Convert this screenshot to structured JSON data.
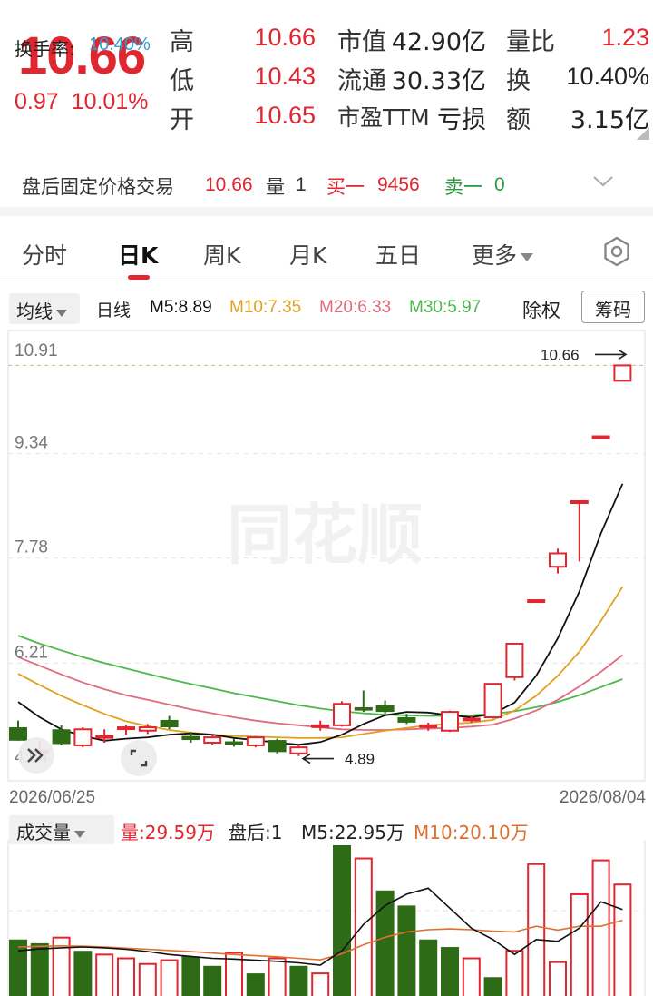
{
  "quote": {
    "price": "10.66",
    "change": "0.97",
    "change_pct": "10.01%",
    "high_label": "高",
    "high": "10.66",
    "low_label": "低",
    "low": "10.43",
    "open_label": "开",
    "open": "10.65",
    "mktcap_label": "市值",
    "mktcap": "42.90亿",
    "float_label": "流通",
    "float": "30.33亿",
    "pe_label": "市盈TTM",
    "pe": "亏损",
    "vol_ratio_label": "量比",
    "vol_ratio": "1.23",
    "turnover_label": "换",
    "turnover": "10.40%",
    "amount_label": "额",
    "amount": "3.15亿"
  },
  "after_hours": {
    "label": "盘后固定价格交易",
    "price": "10.66",
    "vol_label": "量",
    "vol": "1",
    "buy1_label": "买一",
    "buy1": "9456",
    "sell1_label": "卖一",
    "sell1": "0"
  },
  "tabs": [
    "分时",
    "日K",
    "周K",
    "月K",
    "五日",
    "更多"
  ],
  "active_tab": "日K",
  "indicators": {
    "ma_button": "均线",
    "period": "日线",
    "m5": "M5:8.89",
    "m10": "M10:7.35",
    "m20": "M20:6.33",
    "m30": "M30:5.97",
    "adjust": "除权",
    "chips": "筹码"
  },
  "colors": {
    "up": "#e0262f",
    "down": "#2e6b17",
    "m5": "#111111",
    "m10": "#e0a020",
    "m20": "#e06a80",
    "m30": "#4cb84c",
    "turnover": "#2a9fd6"
  },
  "chart_data": {
    "type": "candlestick",
    "y_ticks": [
      "10.91",
      "9.34",
      "7.78",
      "6.21",
      "4.64"
    ],
    "ylim": [
      4.64,
      10.91
    ],
    "x_start": "2026/06/25",
    "x_end": "2026/08/04",
    "max_annotation": "10.66",
    "min_annotation": "4.89",
    "watermark": "同花顺",
    "candles": [
      {
        "o": 5.25,
        "h": 5.35,
        "l": 5.05,
        "c": 5.05
      },
      {
        "o": 4.9,
        "h": 5.05,
        "l": 4.85,
        "c": 4.9
      },
      {
        "o": 5.22,
        "h": 5.28,
        "l": 4.98,
        "c": 5.0
      },
      {
        "o": 4.98,
        "h": 5.25,
        "l": 4.95,
        "c": 5.22
      },
      {
        "o": 5.12,
        "h": 5.22,
        "l": 5.02,
        "c": 5.12
      },
      {
        "o": 5.25,
        "h": 5.28,
        "l": 5.14,
        "c": 5.25
      },
      {
        "o": 5.2,
        "h": 5.3,
        "l": 5.15,
        "c": 5.25
      },
      {
        "o": 5.36,
        "h": 5.42,
        "l": 5.22,
        "c": 5.25
      },
      {
        "o": 5.12,
        "h": 5.18,
        "l": 5.02,
        "c": 5.06
      },
      {
        "o": 5.02,
        "h": 5.15,
        "l": 4.98,
        "c": 5.1
      },
      {
        "o": 5.04,
        "h": 5.08,
        "l": 4.96,
        "c": 4.99
      },
      {
        "o": 4.98,
        "h": 5.12,
        "l": 4.95,
        "c": 5.1
      },
      {
        "o": 5.06,
        "h": 5.08,
        "l": 4.86,
        "c": 4.88
      },
      {
        "o": 4.86,
        "h": 4.98,
        "l": 4.82,
        "c": 4.95
      },
      {
        "o": 5.26,
        "h": 5.35,
        "l": 5.2,
        "c": 5.28
      },
      {
        "o": 5.28,
        "h": 5.64,
        "l": 5.26,
        "c": 5.6
      },
      {
        "o": 5.55,
        "h": 5.8,
        "l": 5.48,
        "c": 5.5
      },
      {
        "o": 5.58,
        "h": 5.65,
        "l": 5.45,
        "c": 5.48
      },
      {
        "o": 5.4,
        "h": 5.45,
        "l": 5.3,
        "c": 5.32
      },
      {
        "o": 5.28,
        "h": 5.32,
        "l": 5.2,
        "c": 5.28
      },
      {
        "o": 5.2,
        "h": 5.5,
        "l": 5.18,
        "c": 5.48
      },
      {
        "o": 5.38,
        "h": 5.44,
        "l": 5.32,
        "c": 5.38
      },
      {
        "o": 5.4,
        "h": 5.9,
        "l": 5.38,
        "c": 5.9
      },
      {
        "o": 6.0,
        "h": 6.5,
        "l": 5.95,
        "c": 6.5
      },
      {
        "o": 7.15,
        "h": 7.15,
        "l": 7.15,
        "c": 7.15
      },
      {
        "o": 7.65,
        "h": 7.92,
        "l": 7.55,
        "c": 7.85
      },
      {
        "o": 8.63,
        "h": 8.63,
        "l": 7.73,
        "c": 8.63
      },
      {
        "o": 9.6,
        "h": 9.6,
        "l": 9.6,
        "c": 9.6
      },
      {
        "o": 10.43,
        "h": 10.66,
        "l": 10.43,
        "c": 10.66
      }
    ],
    "ma5": [
      5.63,
      5.4,
      5.22,
      5.12,
      5.05,
      5.08,
      5.1,
      5.14,
      5.16,
      5.14,
      5.09,
      5.06,
      5.02,
      4.99,
      5.03,
      5.14,
      5.3,
      5.43,
      5.48,
      5.47,
      5.43,
      5.4,
      5.45,
      5.62,
      6.02,
      6.58,
      7.28,
      8.15,
      8.89
    ],
    "ma10": [
      6.05,
      5.88,
      5.72,
      5.58,
      5.45,
      5.34,
      5.27,
      5.21,
      5.17,
      5.14,
      5.12,
      5.11,
      5.1,
      5.09,
      5.09,
      5.1,
      5.15,
      5.2,
      5.24,
      5.28,
      5.3,
      5.32,
      5.36,
      5.5,
      5.72,
      6.02,
      6.38,
      6.84,
      7.35
    ],
    "ma20": [
      6.3,
      6.17,
      6.04,
      5.92,
      5.82,
      5.73,
      5.66,
      5.59,
      5.52,
      5.46,
      5.4,
      5.35,
      5.31,
      5.28,
      5.25,
      5.22,
      5.21,
      5.21,
      5.22,
      5.23,
      5.24,
      5.26,
      5.29,
      5.38,
      5.5,
      5.66,
      5.86,
      6.08,
      6.33
    ],
    "ma30": [
      6.62,
      6.5,
      6.4,
      6.3,
      6.21,
      6.13,
      6.05,
      5.97,
      5.9,
      5.83,
      5.76,
      5.7,
      5.64,
      5.58,
      5.53,
      5.49,
      5.46,
      5.44,
      5.43,
      5.42,
      5.42,
      5.43,
      5.45,
      5.49,
      5.55,
      5.63,
      5.73,
      5.85,
      5.97
    ]
  },
  "volume": {
    "label": "成交量",
    "vol_text": "量:29.59万",
    "after_text": "盘后:1",
    "m5_text": "M5:22.95万",
    "m10_text": "M10:20.10万",
    "turnover_label": "换手率:",
    "turnover_value": "10.40%",
    "vol_max": 40,
    "bars": [
      {
        "v": 15.0,
        "up": false
      },
      {
        "v": 14.0,
        "up": false
      },
      {
        "v": 15.5,
        "up": true
      },
      {
        "v": 12.0,
        "up": false
      },
      {
        "v": 11.0,
        "up": true
      },
      {
        "v": 10.0,
        "up": true
      },
      {
        "v": 8.5,
        "up": true
      },
      {
        "v": 9.5,
        "up": true
      },
      {
        "v": 10.5,
        "up": false
      },
      {
        "v": 8.0,
        "up": false
      },
      {
        "v": 11.5,
        "up": true
      },
      {
        "v": 6.0,
        "up": false
      },
      {
        "v": 10.0,
        "up": true
      },
      {
        "v": 8.0,
        "up": false
      },
      {
        "v": 6.0,
        "up": true
      },
      {
        "v": 40.0,
        "up": false
      },
      {
        "v": 36.5,
        "up": true
      },
      {
        "v": 28.0,
        "up": false
      },
      {
        "v": 24.0,
        "up": false
      },
      {
        "v": 15.0,
        "up": false
      },
      {
        "v": 13.0,
        "up": false
      },
      {
        "v": 10.0,
        "up": true
      },
      {
        "v": 5.0,
        "up": false
      },
      {
        "v": 12.0,
        "up": true
      },
      {
        "v": 35.0,
        "up": true
      },
      {
        "v": 9.0,
        "up": true
      },
      {
        "v": 27.0,
        "up": true
      },
      {
        "v": 36.0,
        "up": true
      },
      {
        "v": 29.59,
        "up": true
      }
    ],
    "ma5": [
      12.0,
      12.5,
      12.8,
      13.0,
      12.8,
      12.4,
      11.8,
      11.0,
      10.5,
      10.0,
      9.8,
      9.5,
      9.2,
      8.8,
      8.2,
      12.0,
      19.0,
      24.0,
      27.0,
      28.6,
      23.3,
      18.0,
      15.0,
      11.0,
      15.0,
      14.5,
      18.0,
      25.0,
      22.95
    ],
    "ma10": [
      13.0,
      13.2,
      13.3,
      13.2,
      13.0,
      12.7,
      12.4,
      12.1,
      11.8,
      11.4,
      11.0,
      10.7,
      10.4,
      10.0,
      9.6,
      11.2,
      13.6,
      15.6,
      17.0,
      17.6,
      17.8,
      17.6,
      17.2,
      17.0,
      18.5,
      17.5,
      18.5,
      18.5,
      20.1
    ]
  }
}
